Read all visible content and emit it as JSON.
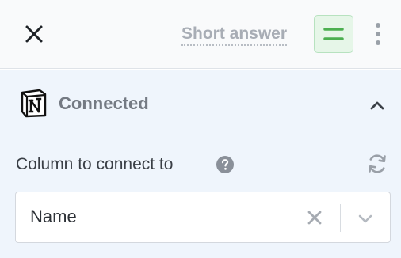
{
  "header": {
    "close_icon": "close-icon",
    "question_type": "Short answer",
    "type_icon": "short-answer-icon",
    "more_icon": "more-vertical-icon",
    "accent": "#4caf50"
  },
  "connection": {
    "logo_icon": "notion-logo-icon",
    "status": "Connected",
    "collapse_icon": "chevron-up-icon"
  },
  "column": {
    "label": "Column to connect to",
    "help_icon": "question-circle-icon",
    "refresh_icon": "refresh-icon",
    "selected_value": "Name",
    "clear_icon": "clear-icon",
    "dropdown_icon": "chevron-down-icon"
  }
}
